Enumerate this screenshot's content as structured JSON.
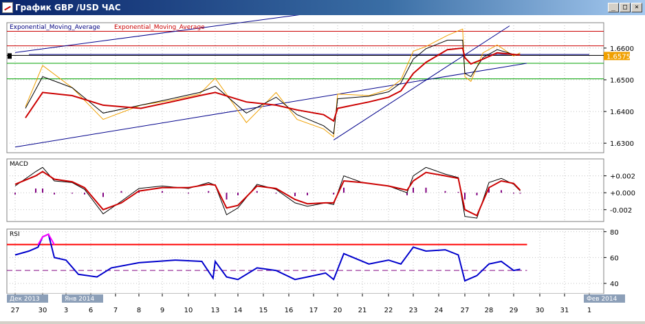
{
  "window": {
    "title": "График GBP /USD ЧАС",
    "minimize_glyph": "_",
    "maximize_glyph": "□",
    "close_glyph": "×",
    "titlebar_color": "#0a246a"
  },
  "chart_data": [
    {
      "id": "price",
      "type": "line",
      "legend": [
        {
          "name": "Exponential_Moving_Average",
          "color": "#000080"
        },
        {
          "name": "Exponential_Moving_Average",
          "color": "#cc0000"
        }
      ],
      "ylim": [
        1.627,
        1.668
      ],
      "y_ticks": [
        "1.6600",
        "1.6500",
        "1.6400",
        "1.6300"
      ],
      "y_tick_values": [
        1.66,
        1.65,
        1.64,
        1.63
      ],
      "current_price_label": "1.6575",
      "current_price": 1.6575,
      "horizontal_levels": [
        {
          "value": 1.6653,
          "color": "#cc0000"
        },
        {
          "value": 1.6607,
          "color": "#cc0000"
        },
        {
          "value": 1.6577,
          "color": "#000000"
        },
        {
          "value": 1.6552,
          "color": "#00a000"
        },
        {
          "value": 1.6503,
          "color": "#00a000"
        }
      ],
      "x": [
        "27 09:00",
        "30 00:00",
        "3 06:00",
        "6 12:00",
        "8 02:00",
        "9 08:00",
        "10 10:00",
        "13 00:00",
        "14 08:00",
        "15 12:00",
        "16 08:00",
        "17 10:00",
        "17 20:00",
        "20 00:00",
        "21 06:00",
        "22 00:00",
        "22 12:00",
        "23 00:00",
        "23 12:00",
        "24 08:00",
        "24 22:00",
        "27 00:00",
        "27 06:00",
        "27 18:00",
        "28 08:00",
        "29 00:00",
        "29 06:00"
      ],
      "series": [
        {
          "color": "#f0a000",
          "values": [
            1.6415,
            1.6545,
            1.6475,
            1.6375,
            1.642,
            1.6435,
            1.6455,
            1.6505,
            1.6365,
            1.646,
            1.6375,
            1.6345,
            1.632,
            1.6455,
            1.645,
            1.647,
            1.65,
            1.659,
            1.6605,
            1.664,
            1.666,
            1.651,
            1.6495,
            1.6585,
            1.661,
            1.6575,
            1.6585
          ]
        },
        {
          "color": "#000000",
          "values": [
            1.641,
            1.651,
            1.6475,
            1.6395,
            1.642,
            1.644,
            1.646,
            1.648,
            1.6395,
            1.6445,
            1.639,
            1.6355,
            1.633,
            1.644,
            1.6448,
            1.6462,
            1.649,
            1.6565,
            1.6598,
            1.6625,
            1.6625,
            1.652,
            1.651,
            1.657,
            1.6595,
            1.658,
            1.658
          ]
        },
        {
          "color": "#cc0000",
          "values": [
            1.638,
            1.646,
            1.645,
            1.642,
            1.641,
            1.643,
            1.645,
            1.646,
            1.643,
            1.642,
            1.6405,
            1.639,
            1.637,
            1.641,
            1.643,
            1.6445,
            1.6465,
            1.652,
            1.6555,
            1.6595,
            1.66,
            1.657,
            1.655,
            1.6565,
            1.6585,
            1.658,
            1.6578
          ]
        }
      ],
      "trendlines": [
        {
          "x": [
            "27 00:00",
            "29 12:00"
          ],
          "y": [
            1.6288,
            1.6552
          ]
        },
        {
          "x": [
            "27 00:00",
            "29 12:00"
          ],
          "y": [
            1.6586,
            1.68
          ]
        },
        {
          "x": [
            "17 20:00",
            "28 20:00"
          ],
          "y": [
            1.631,
            1.667
          ]
        },
        {
          "x": [
            "27 12:00",
            "1 00:00"
          ],
          "y": [
            1.658,
            1.658
          ]
        }
      ]
    },
    {
      "id": "macd",
      "type": "line",
      "label": "MACD",
      "ylim": [
        -0.0034,
        0.004
      ],
      "y_ticks": [
        "+0.002",
        "+0.000",
        "-0.002"
      ],
      "y_tick_values": [
        0.002,
        0.0,
        -0.002
      ],
      "x": [
        "27 00:00",
        "27 18:00",
        "30 00:00",
        "30 12:00",
        "3 06:00",
        "3 18:00",
        "6 12:00",
        "7 06:00",
        "8 00:00",
        "9 00:00",
        "10 00:00",
        "10 18:00",
        "13 00:00",
        "13 12:00",
        "14 00:00",
        "14 18:00",
        "15 12:00",
        "16 06:00",
        "16 18:00",
        "17 12:00",
        "17 20:00",
        "20 06:00",
        "21 00:00",
        "22 00:00",
        "22 18:00",
        "23 00:00",
        "23 12:00",
        "24 06:00",
        "24 18:00",
        "27 00:00",
        "27 12:00",
        "28 00:00",
        "28 12:00",
        "29 00:00",
        "29 06:00"
      ],
      "series": [
        {
          "name": "",
          "color": "#000000",
          "values": [
            0.0008,
            0.0025,
            0.003,
            0.0014,
            0.0012,
            0.0004,
            -0.0025,
            -0.001,
            0.0005,
            0.0008,
            0.0005,
            0.0012,
            0.0009,
            -0.0026,
            -0.0018,
            0.001,
            0.0004,
            -0.0012,
            -0.0016,
            -0.0012,
            -0.0014,
            0.002,
            0.0012,
            0.0008,
            0.0,
            0.002,
            0.003,
            0.0022,
            0.0018,
            -0.0028,
            -0.003,
            0.0012,
            0.0017,
            0.001,
            0.0002
          ]
        },
        {
          "name": "",
          "color": "#cc0000",
          "values": [
            0.001,
            0.002,
            0.0025,
            0.0016,
            0.0013,
            0.0006,
            -0.002,
            -0.0012,
            0.0002,
            0.0006,
            0.0006,
            0.001,
            0.0009,
            -0.0018,
            -0.0015,
            0.0008,
            0.0005,
            -0.0008,
            -0.0013,
            -0.0012,
            -0.0012,
            0.0014,
            0.0012,
            0.0008,
            0.0003,
            0.0014,
            0.0024,
            0.002,
            0.0017,
            -0.002,
            -0.0027,
            0.0006,
            0.0014,
            0.0011,
            0.0003
          ]
        }
      ],
      "histogram": {
        "color": "#800080",
        "values": [
          -0.0002,
          0.0005,
          0.0005,
          -0.0002,
          -0.0001,
          -0.0002,
          -0.0005,
          0.0002,
          0.0003,
          0.0002,
          -0.0001,
          0.0002,
          0.0,
          -0.0008,
          -0.0003,
          0.0002,
          -0.0001,
          -0.0004,
          -0.0003,
          0.0,
          -0.0002,
          0.0006,
          0.0,
          0.0,
          -0.0003,
          0.0006,
          0.0006,
          0.0002,
          0.0001,
          -0.0008,
          -0.0003,
          0.0006,
          0.0003,
          -0.0001,
          -0.0001
        ]
      }
    },
    {
      "id": "rsi",
      "type": "line",
      "label": "RSI",
      "ylim": [
        32,
        82
      ],
      "y_ticks": [
        "80",
        "60",
        "40"
      ],
      "y_tick_values": [
        80,
        60,
        40
      ],
      "levels": [
        {
          "value": 70,
          "color": "#ff0000"
        },
        {
          "value": 50,
          "color": "#800080",
          "style": "dashed"
        },
        {
          "value": 30,
          "color": "#008000"
        }
      ],
      "x": [
        "27 00:00",
        "27 12:00",
        "27 20:00",
        "30 00:00",
        "30 06:00",
        "30 12:00",
        "3 00:00",
        "3 12:00",
        "6 06:00",
        "6 20:00",
        "8 00:00",
        "9 12:00",
        "10 12:00",
        "10 22:00",
        "13 00:00",
        "13 12:00",
        "14 00:00",
        "14 18:00",
        "15 12:00",
        "16 06:00",
        "16 18:00",
        "17 12:00",
        "17 20:00",
        "20 06:00",
        "21 06:00",
        "22 00:00",
        "22 12:00",
        "23 00:00",
        "23 12:00",
        "24 06:00",
        "24 18:00",
        "27 00:00",
        "27 12:00",
        "28 00:00",
        "28 12:00",
        "29 00:00",
        "29 06:00"
      ],
      "series": [
        {
          "name": "",
          "color": "#0000cc",
          "values": [
            62,
            65,
            68,
            76,
            78,
            60,
            58,
            47,
            45,
            52,
            56,
            58,
            57,
            44,
            57,
            45,
            43,
            52,
            50,
            43,
            45,
            48,
            43,
            63,
            55,
            58,
            55,
            68,
            65,
            66,
            62,
            42,
            46,
            55,
            57,
            50,
            51
          ]
        },
        {
          "name": "",
          "color": "#ff00ff",
          "values": [
            null,
            null,
            70,
            76,
            78,
            70,
            null,
            null,
            null,
            null,
            null,
            null,
            null,
            null,
            null,
            null,
            null,
            null,
            null,
            null,
            null,
            null,
            null,
            null,
            null,
            null,
            null,
            null,
            null,
            null,
            null,
            null,
            null,
            null,
            null,
            null,
            null
          ]
        }
      ]
    }
  ],
  "time_axis": {
    "ticks": [
      "27",
      "30",
      "3",
      "6",
      "7",
      "8",
      "9",
      "10",
      "13",
      "14",
      "15",
      "16",
      "17",
      "20",
      "21",
      "22",
      "23",
      "24",
      "27",
      "28",
      "29",
      "30",
      "31",
      "1"
    ],
    "tick_times": [
      "27 00:00",
      "30 00:00",
      "3 00:00",
      "6 00:00",
      "7 00:00",
      "8 00:00",
      "9 00:00",
      "10 00:00",
      "13 00:00",
      "14 00:00",
      "15 00:00",
      "16 00:00",
      "17 00:00",
      "20 00:00",
      "21 00:00",
      "22 00:00",
      "23 00:00",
      "24 00:00",
      "27 00:00",
      "28 00:00",
      "29 00:00",
      "30 00:00",
      "31 00:00",
      "1 00:00"
    ],
    "month_labels": [
      {
        "text": "Дек 2013",
        "at": "27 00:00"
      },
      {
        "text": "Янв 2014",
        "at": "3 00:00"
      },
      {
        "text": "Фев 2014",
        "at": "1 00:00"
      }
    ]
  }
}
